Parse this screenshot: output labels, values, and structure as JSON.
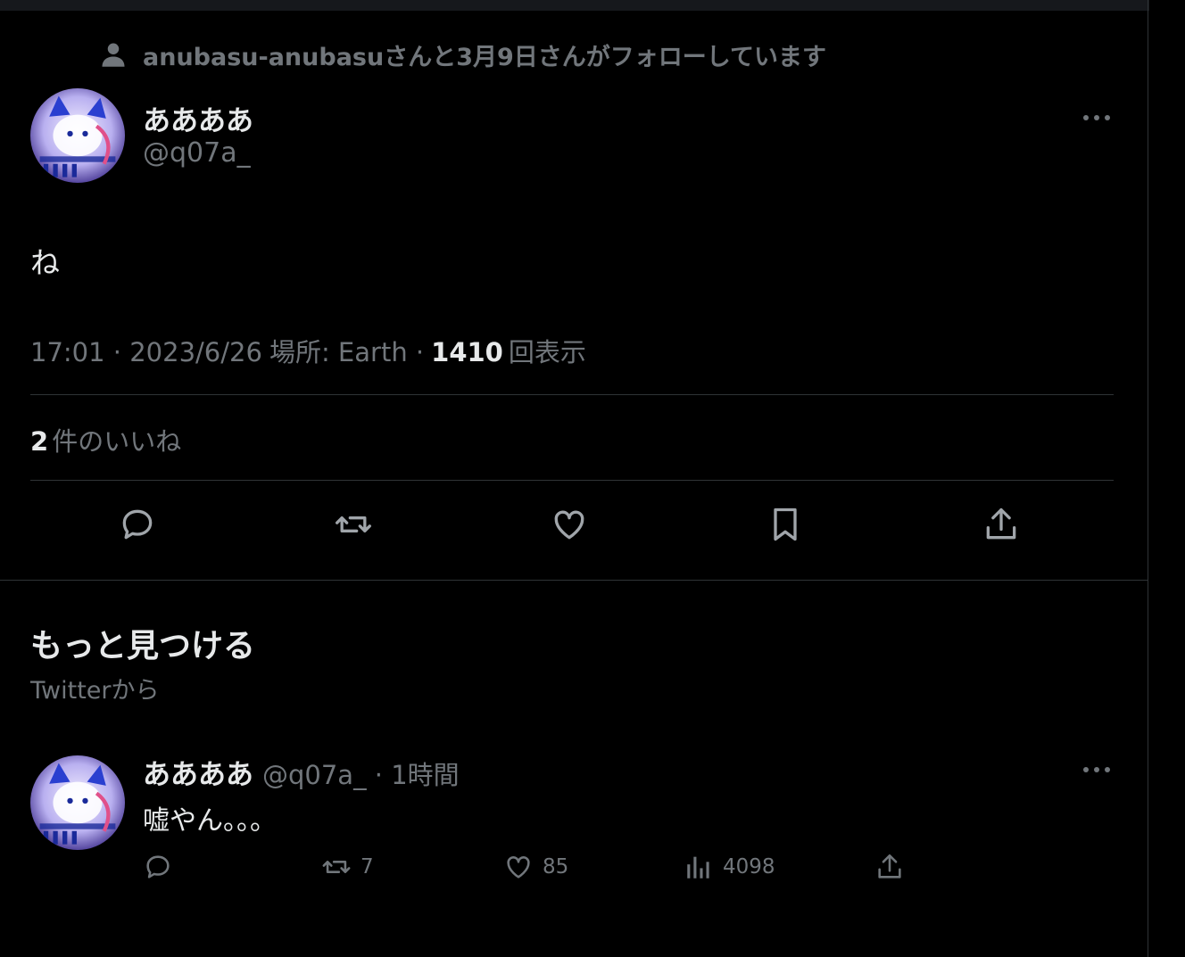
{
  "social_context": "anubasu-anubasuさんと3月9日さんがフォローしています",
  "tweet": {
    "display_name": "ああああ",
    "handle": "@q07a_",
    "text": "ね",
    "time": "17:01 · 2023/6/26",
    "location_label": "場所: Earth ·",
    "views_count": "1410",
    "views_label": "回表示",
    "likes_count": "2",
    "likes_label": "件のいいね"
  },
  "discover": {
    "title": "もっと見つける",
    "subtitle": "Twitterから"
  },
  "related_tweet": {
    "display_name": "ああああ",
    "handle_time": "@q07a_ · 1時間",
    "text": "嘘やん。。。",
    "retweets": "7",
    "likes": "85",
    "views": "4098"
  },
  "icons": [
    "person-icon",
    "more-icon",
    "reply-icon",
    "retweet-icon",
    "like-icon",
    "bookmark-icon",
    "share-icon",
    "views-icon"
  ],
  "colors": {
    "background": "#000000",
    "text": "#e7e9ea",
    "secondary": "#71767b",
    "border": "#2f3336"
  }
}
